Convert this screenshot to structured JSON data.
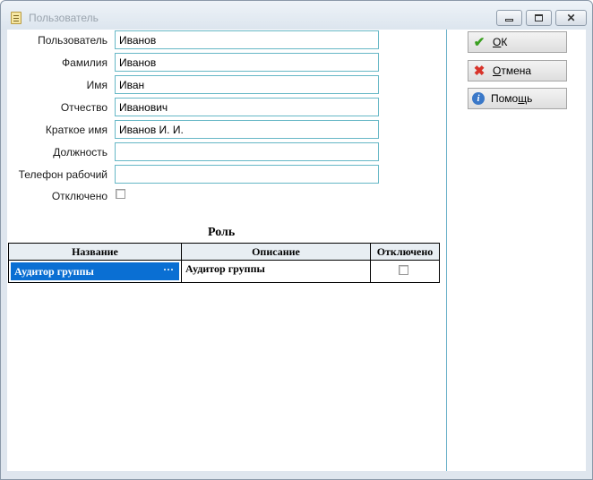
{
  "window": {
    "title": "Пользователь",
    "controls": {
      "minimize": "",
      "maximize": "",
      "close": "✕"
    }
  },
  "form": {
    "fields": [
      {
        "label": "Пользователь",
        "value": "Иванов"
      },
      {
        "label": "Фамилия",
        "value": "Иванов"
      },
      {
        "label": "Имя",
        "value": "Иван"
      },
      {
        "label": "Отчество",
        "value": "Иванович"
      },
      {
        "label": "Краткое имя",
        "value": "Иванов И. И."
      },
      {
        "label": "Должность",
        "value": ""
      },
      {
        "label": "Телефон рабочий",
        "value": ""
      }
    ],
    "disabled": {
      "label": "Отключено",
      "checked": false
    }
  },
  "roles": {
    "title": "Роль",
    "columns": [
      "Название",
      "Описание",
      "Отключено"
    ],
    "rows": [
      {
        "name": "Аудитор группы",
        "description": "Аудитор группы",
        "disabled": false,
        "ellipsis": "···"
      }
    ]
  },
  "buttons": {
    "ok": {
      "label_first": "О",
      "label_rest": "К"
    },
    "cancel": {
      "label_first": "О",
      "label_rest": "тмена"
    },
    "help": {
      "label_first": "П",
      "label_mid": "омо",
      "label_u": "щ",
      "label_end": "ь"
    }
  }
}
